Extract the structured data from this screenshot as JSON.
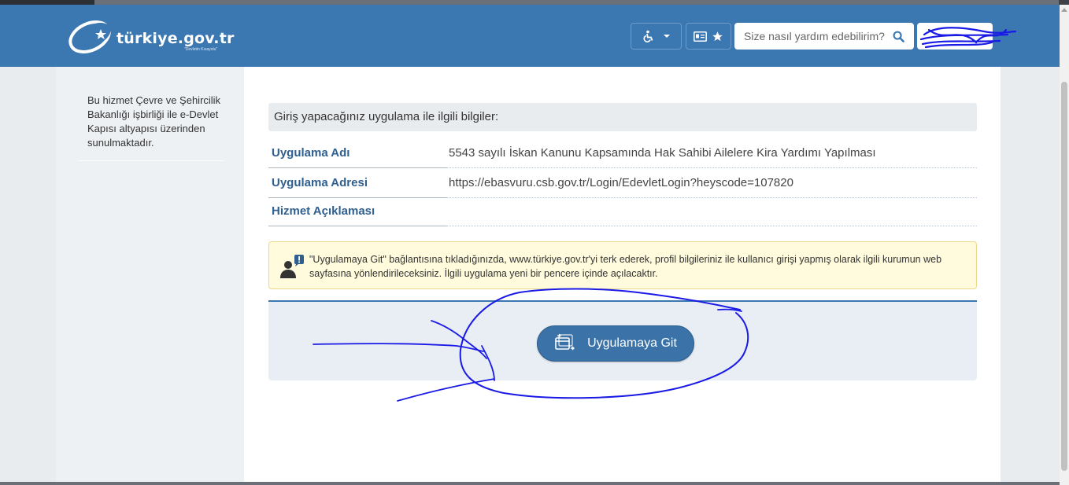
{
  "header": {
    "logo_text": "türkiye.gov.tr",
    "logo_subtext": "\"Devletin Kısayolu\"",
    "search_placeholder": "Size nasıl yardım edebilirim?",
    "accessibility_icon": "wheelchair-icon",
    "favorites_icons": [
      "id-card-icon",
      "star-icon"
    ]
  },
  "sidebar": {
    "note": "Bu hizmet Çevre ve Şehircilik Bakanlığı işbirliği ile e-Devlet Kapısı altyapısı üzerinden sunulmaktadır."
  },
  "main": {
    "info_header": "Giriş yapacağınız uygulama ile ilgili bilgiler:",
    "rows": [
      {
        "label": "Uygulama Adı",
        "value": "5543 sayılı İskan Kanunu Kapsamında Hak Sahibi Ailelere Kira Yardımı Yapılması"
      },
      {
        "label": "Uygulama Adresi",
        "value": "https://ebasvuru.csb.gov.tr/Login/EdevletLogin?heyscode=107820"
      },
      {
        "label": "Hizmet Açıklaması",
        "value": ""
      }
    ],
    "notice": "\"Uygulamaya Git\" bağlantısına tıkladığınızda, www.türkiye.gov.tr'yi terk ederek, profil bilgileriniz ile kullanıcı girişi yapmış olarak ilgili kurumun web sayfasına yönlendirileceksiniz. İlgili uygulama yeni bir pencere içinde açılacaktır.",
    "go_button": "Uygulamaya Git"
  },
  "colors": {
    "header_bg": "#3b77b0",
    "button_bg": "#3b73a8",
    "label_color": "#2f5f8f",
    "notice_bg": "#fffbdc",
    "annotation_ink": "#1a1ae6"
  }
}
